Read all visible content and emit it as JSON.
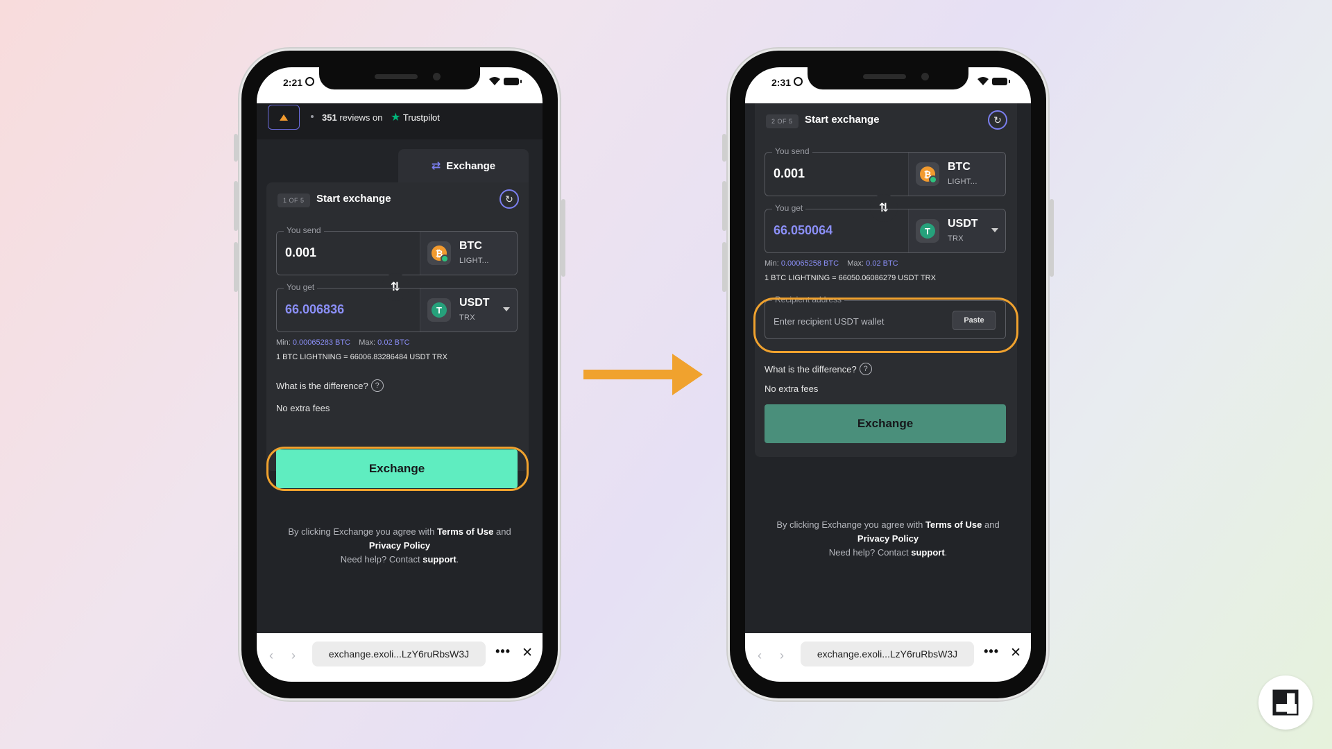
{
  "left": {
    "status": {
      "time": "2:21"
    },
    "header": {
      "reviews_count": "351",
      "reviews_text": "reviews on",
      "trustpilot": "Trustpilot"
    },
    "tab": {
      "label": "Exchange"
    },
    "step": {
      "badge": "1 OF 5",
      "title": "Start exchange"
    },
    "send": {
      "legend": "You send",
      "amount": "0.001",
      "coin": "BTC",
      "network": "LIGHT..."
    },
    "get": {
      "legend": "You get",
      "amount": "66.006836",
      "coin": "USDT",
      "network": "TRX"
    },
    "limits": {
      "min_label": "Min:",
      "min_value": "0.00065283 BTC",
      "max_label": "Max:",
      "max_value": "0.02 BTC"
    },
    "rate": "1 BTC LIGHTNING = 66006.83286484 USDT TRX",
    "difference": "What is the difference?",
    "fees": "No extra fees",
    "exchange_button": "Exchange",
    "terms": {
      "prefix": "By clicking Exchange you agree with",
      "terms_link": "Terms of Use",
      "and": "and",
      "privacy_link": "Privacy Policy",
      "help": "Need help? Contact",
      "support_link": "support",
      "period": "."
    },
    "browser": {
      "url": "exchange.exoli...LzY6ruRbsW3J"
    }
  },
  "right": {
    "status": {
      "time": "2:31"
    },
    "step": {
      "badge": "2 OF 5",
      "title": "Start exchange"
    },
    "send": {
      "legend": "You send",
      "amount": "0.001",
      "coin": "BTC",
      "network": "LIGHT..."
    },
    "get": {
      "legend": "You get",
      "amount": "66.050064",
      "coin": "USDT",
      "network": "TRX"
    },
    "limits": {
      "min_label": "Min:",
      "min_value": "0.00065258 BTC",
      "max_label": "Max:",
      "max_value": "0.02 BTC"
    },
    "rate": "1 BTC LIGHTNING = 66050.06086279 USDT TRX",
    "recipient": {
      "legend": "Recipient address",
      "placeholder": "Enter recipient USDT wallet",
      "paste": "Paste"
    },
    "difference": "What is the difference?",
    "fees": "No extra fees",
    "exchange_button": "Exchange",
    "terms": {
      "prefix": "By clicking Exchange you agree with",
      "terms_link": "Terms of Use",
      "and": "and",
      "privacy_link": "Privacy Policy",
      "help": "Need help? Contact",
      "support_link": "support",
      "period": "."
    },
    "browser": {
      "url": "exchange.exoli...LzY6ruRbsW3J"
    }
  },
  "colors": {
    "highlight": "#f0a22e",
    "accent_purple": "#8b8ff7",
    "exchange_active": "#5fedc0",
    "exchange_disabled": "#4a8f7b",
    "btc": "#f29a2e",
    "usdt": "#26a17b"
  },
  "icons": [
    "arrow-right-icon",
    "swap-icon",
    "refresh-icon",
    "help-icon",
    "more-icon",
    "close-icon",
    "back-icon",
    "forward-icon",
    "brand-logo-icon"
  ]
}
